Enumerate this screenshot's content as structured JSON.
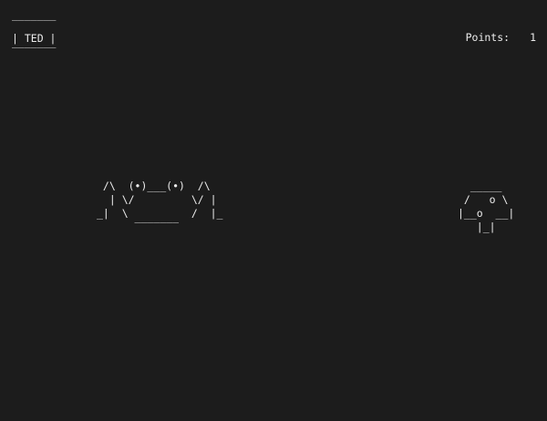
{
  "title": {
    "top": "‾‾‾‾‾‾‾",
    "middle": "| TED |",
    "bottom": "‾‾‾‾‾‾‾"
  },
  "score": {
    "label": "Points:",
    "value": "1"
  },
  "player_crab": {
    "art": " /\\  (•)___(•)  /\\\n  | \\/         \\/ |\n_|  \\          /  |_\n      ‾‾‾‾‾‾‾"
  },
  "shell_obstacle": {
    "art": "  _____\n /   o \\\n|__o  __|\n   |_|"
  }
}
